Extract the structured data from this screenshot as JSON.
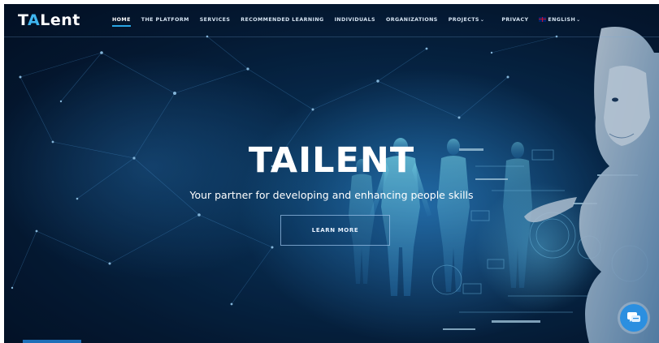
{
  "logo": {
    "part1": "T",
    "accent": "A",
    "part2": "Lent"
  },
  "nav": {
    "items": [
      {
        "label": "HOME"
      },
      {
        "label": "THE PLATFORM"
      },
      {
        "label": "SERVICES"
      },
      {
        "label": "RECOMMENDED LEARNING"
      },
      {
        "label": "INDIVIDUALS"
      },
      {
        "label": "ORGANIZATIONS"
      },
      {
        "label": "PROJECTS"
      },
      {
        "label": "PRIVACY"
      },
      {
        "label": "ENGLISH"
      }
    ],
    "active": "HOME"
  },
  "hero": {
    "title": "TAILENT",
    "subtitle": "Your partner for developing and enhancing people skills",
    "button_label": "LEARN MORE"
  },
  "icons": {
    "chat": "chat-bubble-icon",
    "dropdown": "chevron-down-icon",
    "flag": "uk-flag-icon"
  },
  "colors": {
    "accent": "#2aa7e6",
    "background": "#041a33",
    "chat_button": "#2b8fe0"
  }
}
